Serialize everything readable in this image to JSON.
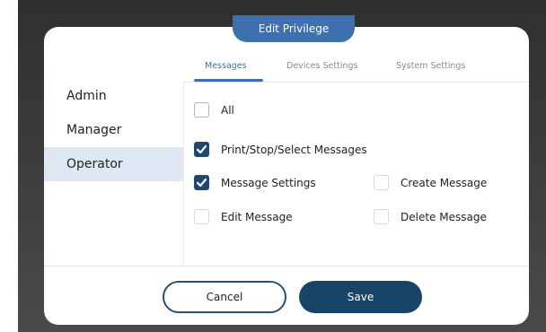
{
  "dialog": {
    "title": "Edit Privilege"
  },
  "sidebar": {
    "items": [
      {
        "label": "Admin",
        "active": false
      },
      {
        "label": "Manager",
        "active": false
      },
      {
        "label": "Operator",
        "active": true
      }
    ]
  },
  "tabs": [
    {
      "label": "Messages",
      "active": true
    },
    {
      "label": "Devices Settings",
      "active": false
    },
    {
      "label": "System Settings",
      "active": false
    }
  ],
  "permissions": {
    "all": {
      "label": "All",
      "checked": false
    },
    "print_stop_select": {
      "label": "Print/Stop/Select Messages",
      "checked": true
    },
    "message_settings": {
      "label": "Message Settings",
      "checked": true
    },
    "create_message": {
      "label": "Create Message",
      "checked": false
    },
    "edit_message": {
      "label": "Edit Message",
      "checked": false
    },
    "delete_message": {
      "label": "Delete Message",
      "checked": false
    }
  },
  "buttons": {
    "cancel_label": "Cancel",
    "save_label": "Save"
  },
  "colors": {
    "accent": "#3e6fae",
    "primary_dark": "#184467",
    "checkbox_checked": "#20476e",
    "sidebar_active": "#dfe7f3"
  }
}
